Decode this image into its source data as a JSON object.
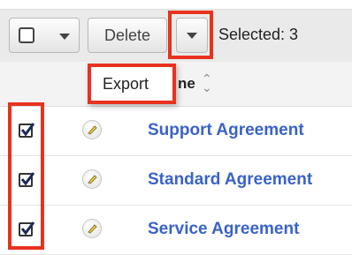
{
  "toolbar": {
    "delete_label": "Delete",
    "selected_label": "Selected: 3"
  },
  "dropdown": {
    "export_label": "Export"
  },
  "table": {
    "name_header_partial": "ne",
    "rows": [
      {
        "name": "Support Agreement",
        "checked": true
      },
      {
        "name": "Standard Agreement",
        "checked": true
      },
      {
        "name": "Service Agreement",
        "checked": true
      }
    ]
  },
  "colors": {
    "link": "#3a62c8",
    "highlight": "#e8321f"
  },
  "icons": [
    "caret-down-icon",
    "sort-icon",
    "checkmark-icon",
    "pencil-icon"
  ]
}
